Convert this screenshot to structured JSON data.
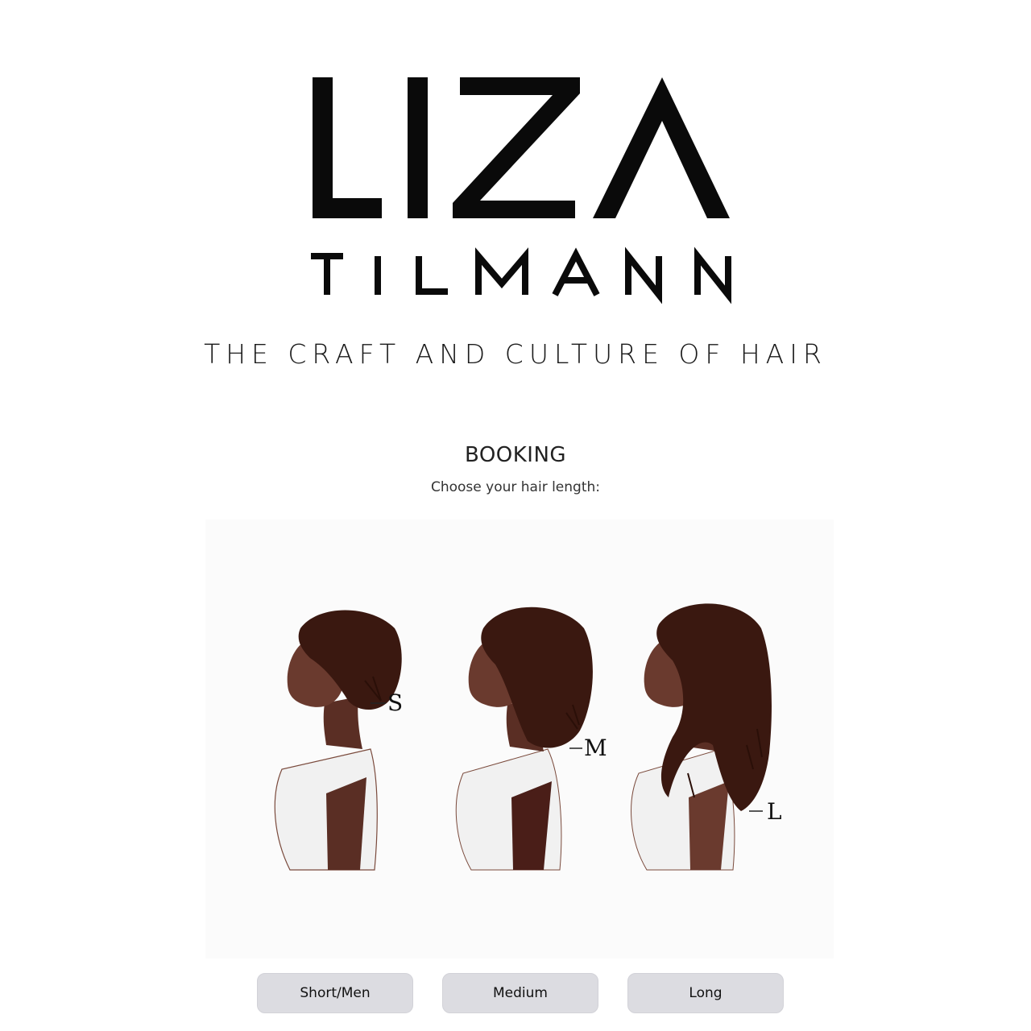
{
  "brand": {
    "logo_line1": "LIZA",
    "logo_line2": "TILMANN",
    "tagline": "THE CRAFT AND CULTURE OF HAIR"
  },
  "booking": {
    "heading": "BOOKING",
    "prompt": "Choose your hair length:"
  },
  "illustration": {
    "labels": [
      "S",
      "M",
      "L"
    ]
  },
  "options": [
    {
      "label": "Short/Men"
    },
    {
      "label": "Medium"
    },
    {
      "label": "Long"
    }
  ],
  "colors": {
    "logo": "#0a0a0a",
    "button_bg": "#dcdce1",
    "skin": "#6a3a2e",
    "hair": "#3a1810",
    "shirt": "#f2f2f2"
  }
}
